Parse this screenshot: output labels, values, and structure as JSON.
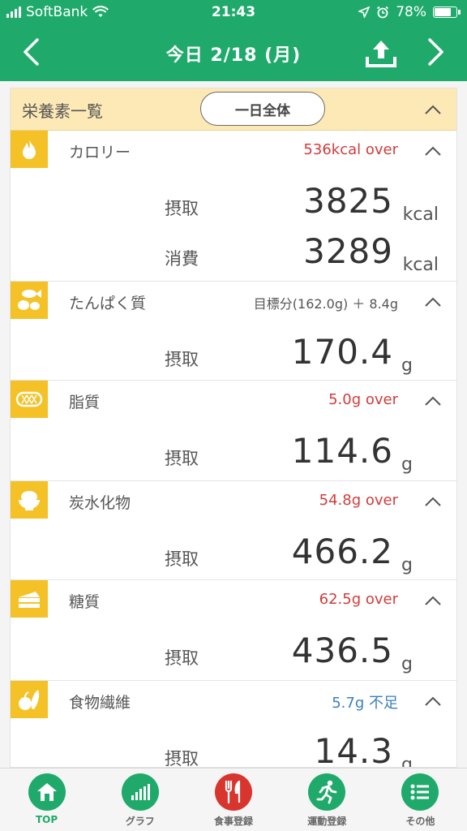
{
  "status_bar": {
    "carrier": "SoftBank",
    "time": "21:43",
    "battery": "78%",
    "battery_level": 0.78
  },
  "nav": {
    "title": "今日 2/18 (月)"
  },
  "summary": {
    "title": "栄養素一覧",
    "period_button": "一日全体"
  },
  "nutrients": [
    {
      "name": "カロリー",
      "status": "536kcal over",
      "status_type": "over",
      "rows": [
        {
          "label": "摂取",
          "value": "3825",
          "unit": "kcal"
        },
        {
          "label": "消費",
          "value": "3289",
          "unit": "kcal"
        }
      ]
    },
    {
      "name": "たんぱく質",
      "status": "目標分(162.0g) ＋ 8.4g",
      "status_type": "neutral",
      "rows": [
        {
          "label": "摂取",
          "value": "170.4",
          "unit": "g"
        }
      ]
    },
    {
      "name": "脂質",
      "status": "5.0g over",
      "status_type": "over",
      "rows": [
        {
          "label": "摂取",
          "value": "114.6",
          "unit": "g"
        }
      ]
    },
    {
      "name": "炭水化物",
      "status": "54.8g over",
      "status_type": "over",
      "rows": [
        {
          "label": "摂取",
          "value": "466.2",
          "unit": "g"
        }
      ]
    },
    {
      "name": "糖質",
      "status": "62.5g over",
      "status_type": "over",
      "rows": [
        {
          "label": "摂取",
          "value": "436.5",
          "unit": "g"
        }
      ]
    },
    {
      "name": "食物繊維",
      "status": "5.7g 不足",
      "status_type": "short",
      "rows": [
        {
          "label": "摂取",
          "value": "14.3",
          "unit": "g"
        }
      ]
    }
  ],
  "tabs": [
    {
      "label": "TOP",
      "icon": "home-icon"
    },
    {
      "label": "グラフ",
      "icon": "graph-icon"
    },
    {
      "label": "食事登録",
      "icon": "fork-knife-icon"
    },
    {
      "label": "運動登録",
      "icon": "runner-icon"
    },
    {
      "label": "その他",
      "icon": "list-icon"
    }
  ],
  "colors": {
    "brand": "#1faa6b",
    "accent": "#f4c227",
    "over": "#d23b3b",
    "short": "#3b7fc0",
    "meal": "#d8352f"
  }
}
